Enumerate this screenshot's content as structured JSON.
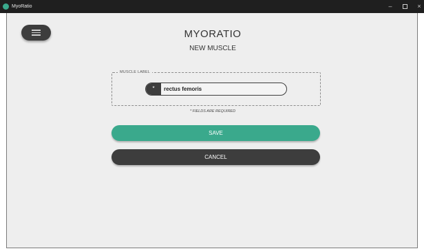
{
  "window": {
    "title": "MyoRatio",
    "controls": {
      "minimize": "–",
      "close": "×"
    }
  },
  "header": {
    "app_name": "MYORATIO",
    "subtitle": "NEW MUSCLE"
  },
  "form": {
    "legend": "MUSCLE LABEL",
    "required_marker": "*",
    "input_value": "rectus femoris",
    "required_note": "* FIELDS ARE REQUIRED"
  },
  "actions": {
    "save_label": "SAVE",
    "cancel_label": "CANCEL"
  },
  "colors": {
    "accent": "#3aa98c",
    "dark": "#3d3d3d",
    "background": "#eeeeee"
  },
  "icons": {
    "menu": "hamburger-menu-icon",
    "app": "app-logo-icon"
  }
}
